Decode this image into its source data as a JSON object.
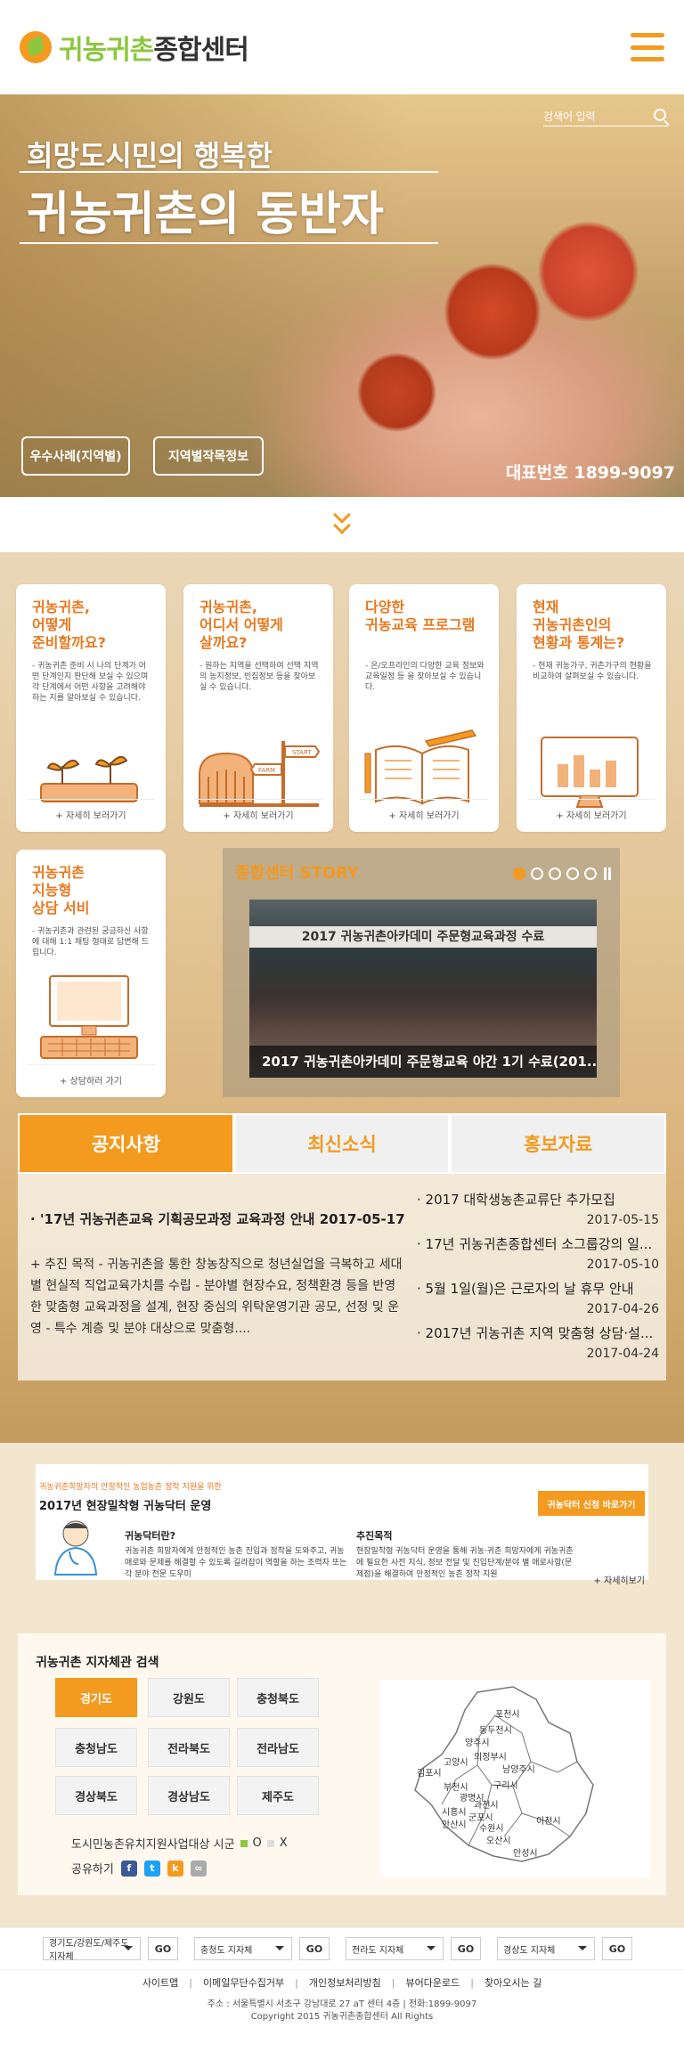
{
  "header": {
    "logo_green": "귀농귀촌",
    "logo_dark": "종합센터"
  },
  "hero": {
    "search_placeholder": "검색어 입력",
    "subtitle": "희망도시민의 행복한",
    "title": "귀농귀촌의 동반자",
    "btn1": "우수사례(지역별)",
    "btn2": "지역별작목정보",
    "phone": "대표번호 1899-9097"
  },
  "cards": [
    {
      "title": "귀농귀촌,\n어떻게\n준비할까요?",
      "desc": "- 귀농귀촌 준비 시 나의 단계가 어떤 단계인지 판단해 보실 수 있으며 각 단계에서 어떤 사항을 고려해야 하는 지를 알아보실 수 있습니다.",
      "more": "+ 자세히 보러가기"
    },
    {
      "title": "귀농귀촌,\n어디서 어떻게\n살까요?",
      "desc": "- 원하는 지역을 선택하여 선택 지역의 농지정보, 빈집정보 등을 찾아보실 수 있습니다.",
      "more": "+ 자세히 보러가기"
    },
    {
      "title": "다양한\n귀농교육 프로그램",
      "desc": "- 온/오프라인의 다양한 교육 정보와 교육일정 등 을 찾아보실 수 있습니다.",
      "more": "+ 자세히 보러가기"
    },
    {
      "title": "현재\n귀농귀촌인의\n현황과 통계는?",
      "desc": "- 현재 귀농가구, 귀촌가구의 현황을 비교하여 살펴보실 수 있습니다.",
      "more": "+ 자세히 보러가기"
    },
    {
      "title": "귀농귀촌\n지능형\n상담 서비",
      "desc": "- 귀농귀촌과 관련된 궁금하신 사항에 대해 1:1 채팅 형태로 답변해 드립니다.",
      "more": "+ 상담하러 가기"
    }
  ],
  "sign": {
    "s1": "START",
    "s2": "FARM"
  },
  "story": {
    "title": "종합센터 STORY",
    "banner": "2017 귀농귀촌아카데미 주문형교육과정 수료",
    "caption": "2017 귀농귀촌아카데미 주문형교육 야간 1기 수료(201..."
  },
  "tabs": [
    "공지사항",
    "최신소식",
    "홍보자료"
  ],
  "notice": {
    "title": "· '17년 귀농귀촌교육 기획공모과정 교육과정 안내   2017-05-17",
    "body": "+ 추진 목적  - 귀농귀촌을 통한 창농창직으로 청년실업을 극복하고 세대별 현실적 직업교육가치를 수립  - 분야별 현장수요, 정책환경 등을 반영한 맞춤형 교육과정을 설계, 현장 중심의 위탁운영기관 공모, 선정 및 운영  - 특수 계층 및 분야 대상으로 맞춤형...."
  },
  "news": [
    {
      "title": "· 2017 대학생농촌교류단 추가모집",
      "date": "2017-05-15"
    },
    {
      "title": "· 17년 귀농귀촌종합센터 소그룹강의 일...",
      "date": "2017-05-10"
    },
    {
      "title": "· 5월 1일(월)은 근로자의 날 휴무 안내",
      "date": "2017-04-26"
    },
    {
      "title": "· 2017년 귀농귀촌 지역 맞춤형 상담·설...",
      "date": "2017-04-24"
    }
  ],
  "doctor": {
    "kicker": "귀농귀촌희망자의 안정적인 농업농촌 정착 지원을 위한",
    "title": "2017년 현장밀착형 귀농닥터 운영",
    "cta": "귀농닥터 신청 바로가기",
    "s1_head": "귀농닥터란?",
    "s1_body": "귀농귀촌 희망자에게 안정적인 농촌 진입과 정착을 도와주고, 귀농애로와 문제를 해결할 수 있도록 길라잡이 역할을 하는 조력자 또는 각 분야 전문 도우미",
    "s2_head": "추진목적",
    "s2_body": "현장밀착형 귀농닥터 운영을 통해 귀농·귀촌 희망자에게 귀농귀촌에 필요한 사전 지식, 정보 전달 및 진입단계/분야 별 애로사항(문제점)을 해결하여 안정적인 농촌 정착 지원",
    "more": "+ 자세히보기"
  },
  "region": {
    "title": "귀농귀촌 지자체관 검색",
    "buttons": [
      "경기도",
      "강원도",
      "충청북도",
      "충청남도",
      "전라북도",
      "전라남도",
      "경상북도",
      "경상남도",
      "제주도"
    ],
    "legend_text": "도시민농촌유치지원사업대상 시군",
    "legend_yes": "O",
    "legend_no": "X",
    "share_label": "공유하기"
  },
  "map_labels": [
    "포천시",
    "동두천시",
    "양주시",
    "고양시",
    "의정부시",
    "남양주시",
    "김포시",
    "구리시",
    "부천시",
    "광명시",
    "과천시",
    "시흥시",
    "안산시",
    "군포시",
    "수원시",
    "오산시",
    "이천시",
    "안성시"
  ],
  "footer": {
    "selects": [
      "경기도/강원도/제주도 지자체",
      "충청도 지자체",
      "전라도 지자체",
      "경상도 지자체"
    ],
    "go": "GO",
    "links": [
      "사이트맵",
      "이메일무단수집거부",
      "개인정보처리방침",
      "뷰어다운로드",
      "찾아오시는 길"
    ],
    "address": "주소 : 서울특별시 서초구 강남대로 27 aT 센터 4층   |   전화:1899-9097",
    "copyright": "Copyright 2015 귀농귀촌종합센터 All Rights"
  },
  "colors": {
    "accent": "#f39a1f",
    "green": "#8dc63f"
  }
}
